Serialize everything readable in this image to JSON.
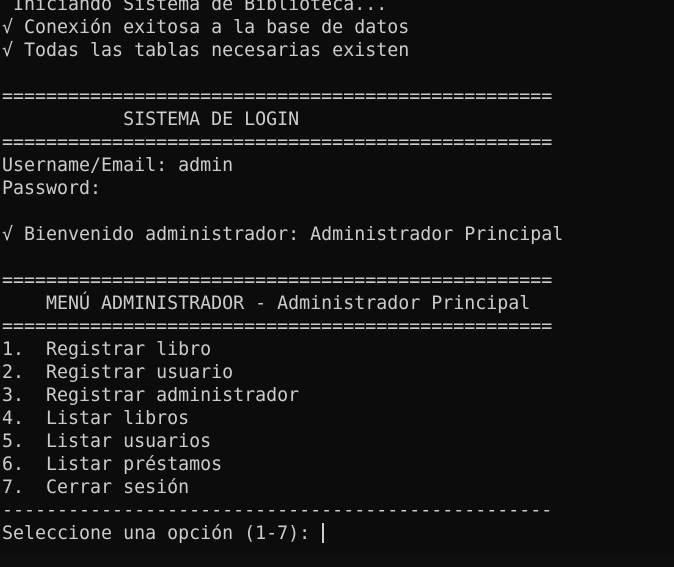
{
  "terminal": {
    "startup": [
      " Iniciando Sistema de Biblioteca...",
      "√ Conexión exitosa a la base de datos",
      "√ Todas las tablas necesarias existen"
    ],
    "login_separator_top": "==================================================",
    "login_title": "           SISTEMA DE LOGIN",
    "login_separator_bottom": "==================================================",
    "username_prompt": "Username/Email: admin",
    "password_prompt": "Password:",
    "welcome_message": "√ Bienvenido administrador: Administrador Principal",
    "menu_separator_top": "==================================================",
    "menu_title": "    MENÚ ADMINISTRADOR - Administrador Principal",
    "menu_separator_bottom": "==================================================",
    "menu_items": [
      "1.  Registrar libro",
      "2.  Registrar usuario",
      "3.  Registrar administrador",
      "4.  Listar libros",
      "5.  Listar usuarios",
      "6.  Listar préstamos",
      "7.  Cerrar sesión"
    ],
    "menu_divider": "--------------------------------------------------",
    "input_prompt": "Seleccione una opción (1-7): "
  }
}
